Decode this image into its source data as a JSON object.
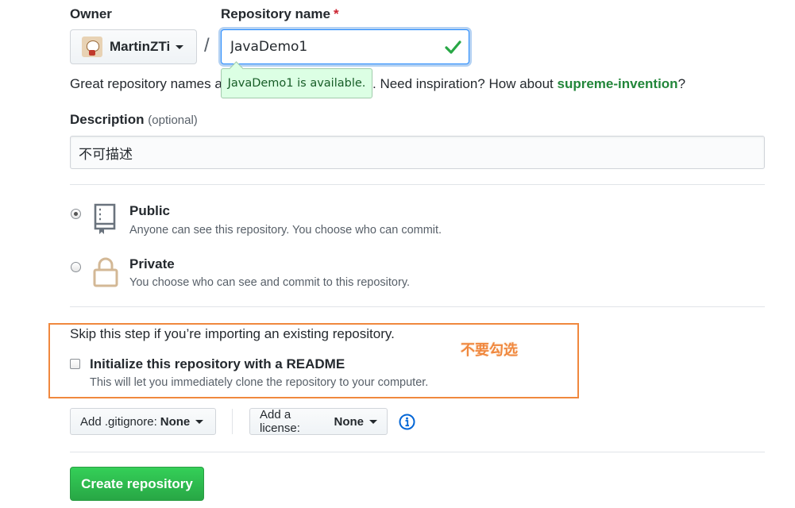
{
  "owner": {
    "label": "Owner",
    "name": "MartinZTi"
  },
  "repo_name": {
    "label": "Repository name",
    "required_mark": "*",
    "value": "JavaDemo1",
    "available_tooltip": "JavaDemo1 is available."
  },
  "hint": {
    "prefix": "Great repository names a",
    "suffix": ". Need inspiration? How about ",
    "suggestion": "supreme-invention",
    "end": "?"
  },
  "description": {
    "label": "Description",
    "optional": "(optional)",
    "value": "不可描述"
  },
  "visibility": {
    "public": {
      "title": "Public",
      "desc": "Anyone can see this repository. You choose who can commit.",
      "selected": true
    },
    "private": {
      "title": "Private",
      "desc": "You choose who can see and commit to this repository.",
      "selected": false
    }
  },
  "init": {
    "skip_text": "Skip this step if you’re importing an existing repository.",
    "readme_label": "Initialize this repository with a README",
    "readme_desc": "This will let you immediately clone the repository to your computer.",
    "checked": false,
    "annotation": "不要勾选"
  },
  "gitignore": {
    "label": "Add .gitignore:",
    "value": "None"
  },
  "license": {
    "label": "Add a license:",
    "value": "None"
  },
  "create_button": "Create repository",
  "colors": {
    "accent_green": "#28a745",
    "focus_blue": "#2188ff",
    "annotation_orange": "#f0883e"
  }
}
